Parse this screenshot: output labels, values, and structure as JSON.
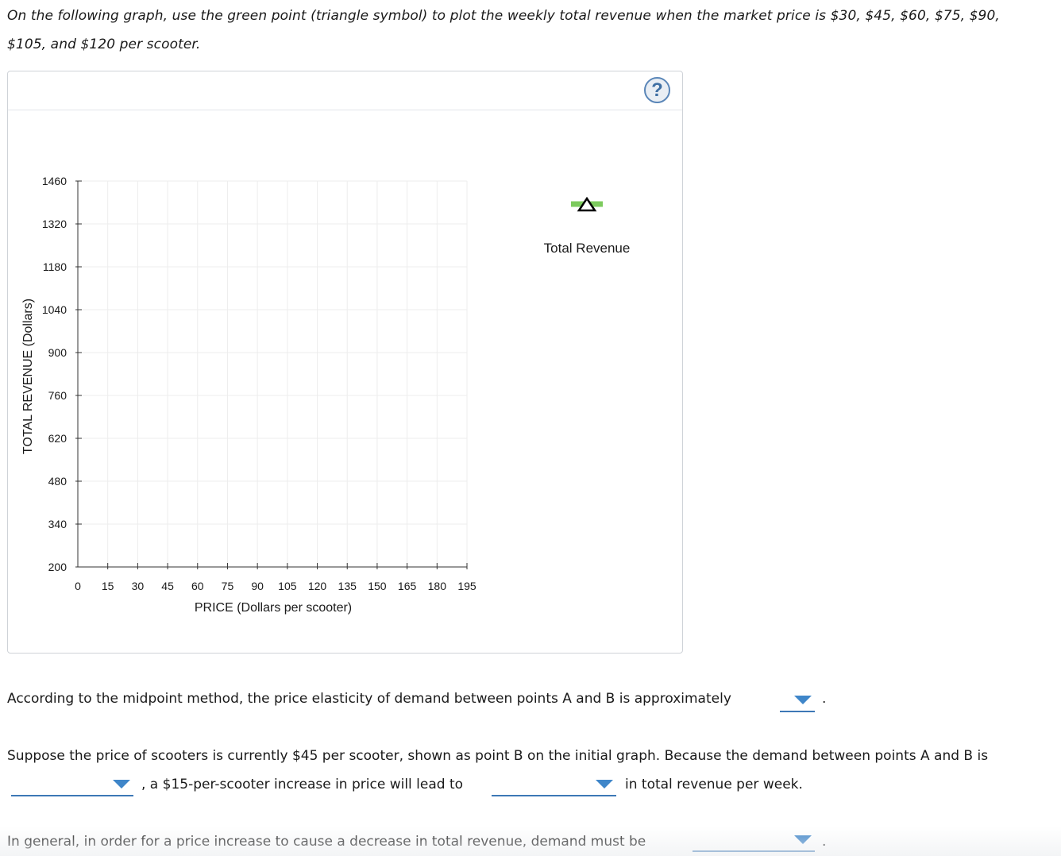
{
  "instructions": {
    "line1": "On the following graph, use the green point (triangle symbol) to plot the weekly total revenue when the market price is $30, $45, $60, $75, $90,",
    "line2": "$105, and $120 per scooter."
  },
  "panel": {
    "help_label": "?",
    "help_icon": "question-circle-icon",
    "palette": {
      "label": "Total Revenue",
      "tool_color": "#7dcb5e",
      "tool_icon": "triangle-icon"
    }
  },
  "chart_data": {
    "type": "scatter",
    "xlabel": "PRICE (Dollars per scooter)",
    "ylabel": "TOTAL REVENUE (Dollars)",
    "xlim": [
      0,
      195
    ],
    "ylim": [
      200,
      1460
    ],
    "xticks": [
      0,
      15,
      30,
      45,
      60,
      75,
      90,
      105,
      120,
      135,
      150,
      165,
      180,
      195
    ],
    "yticks": [
      200,
      340,
      480,
      620,
      760,
      900,
      1040,
      1180,
      1320,
      1460
    ],
    "grid": true,
    "series": []
  },
  "questions": {
    "q1": {
      "text": "According to the midpoint method, the price elasticity of demand between points A and B is approximately",
      "end": "."
    },
    "q2": {
      "text_a": "Suppose the price of scooters is currently $45 per scooter, shown as point B on the initial graph. Because the demand between points A and B is",
      "text_b": ", a $15-per-scooter increase in price will lead to",
      "text_c": "in total revenue per week."
    },
    "q3": {
      "text": "In general, in order for a price increase to cause a decrease in total revenue, demand must be",
      "end": "."
    }
  }
}
